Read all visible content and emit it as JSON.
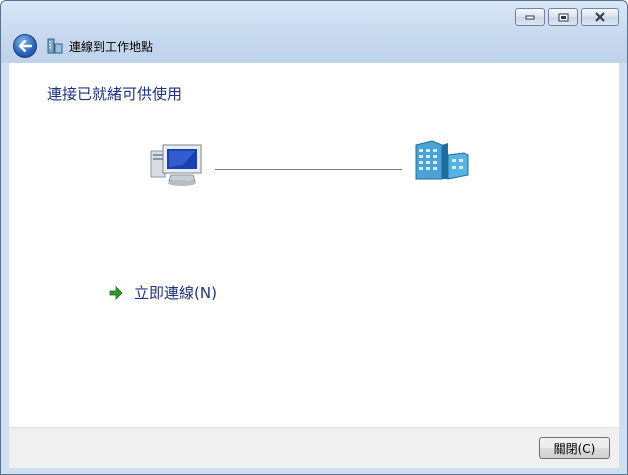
{
  "titlebar": {
    "minimize": "minimize-icon",
    "maximize": "maximize-icon",
    "close": "close-icon"
  },
  "nav": {
    "back_icon": "back-arrow-icon",
    "title": "連線到工作地點"
  },
  "main": {
    "heading": "連接已就緒可供使用",
    "computer_icon": "computer-icon",
    "network_icon": "workplace-server-icon",
    "connect_now": "立即連線(N)"
  },
  "footer": {
    "close_label": "關閉(C)"
  },
  "colors": {
    "link_text": "#1e3287",
    "chrome": "#cfdff0",
    "footer_bg": "#f0f0f0"
  }
}
